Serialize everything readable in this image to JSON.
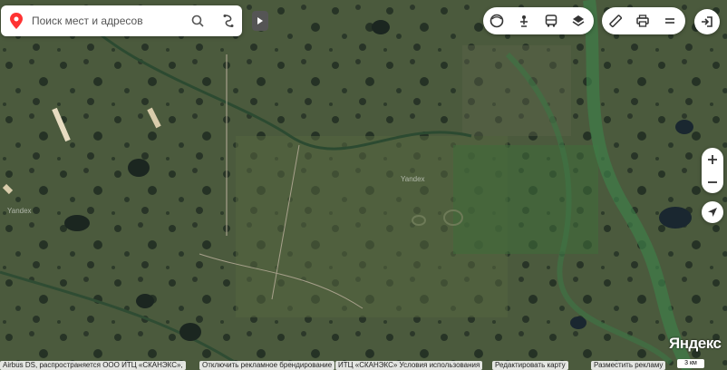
{
  "search": {
    "placeholder": "Поиск мест и адресов"
  },
  "watermarks": [
    "Yandex",
    "Yandex"
  ],
  "footer": {
    "attribution": "Airbus DS, распространяется ООО ИТЦ «СКАНЭКС»,",
    "disable_branding": "Отключить рекламное брендирование",
    "scanex_terms": "ИТЦ «СКАНЭКС» Условия использования",
    "edit_map": "Редактировать карту",
    "place_ad": "Разместить рекламу"
  },
  "logo": "Яндекс",
  "scale_label": "3 км",
  "icons": [
    "map-pin-icon",
    "search-icon",
    "route-icon",
    "collapse-arrow-icon",
    "panorama-icon",
    "transit-icon",
    "bus-icon",
    "layers-icon",
    "ruler-icon",
    "print-icon",
    "menu-icon",
    "login-icon",
    "zoom-in-icon",
    "zoom-out-icon",
    "location-arrow-icon"
  ],
  "colors": {
    "pin": "#f33",
    "panel": "#ffffff",
    "map_base": "#3c4a33"
  }
}
